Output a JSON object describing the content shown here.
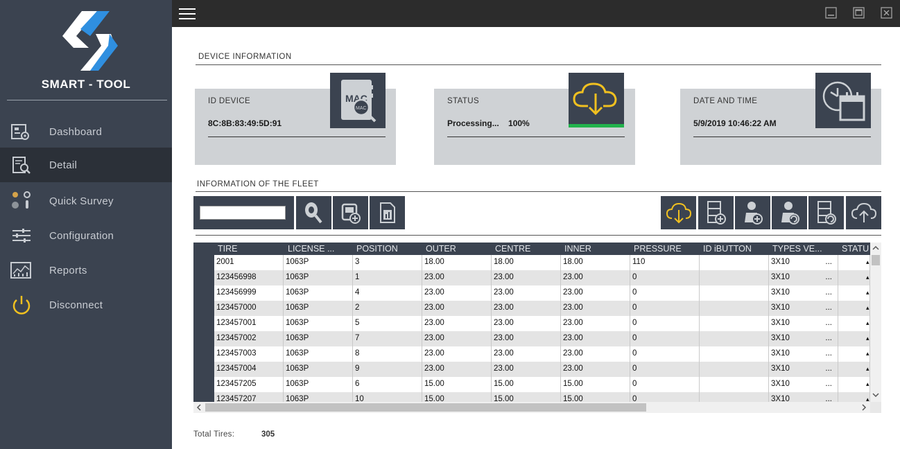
{
  "brand": "SMART - TOOL",
  "nav": [
    {
      "label": "Dashboard",
      "icon": "dashboard-icon"
    },
    {
      "label": "Detail",
      "icon": "detail-icon"
    },
    {
      "label": "Quick  Survey",
      "icon": "quick-survey-icon"
    },
    {
      "label": "Configuration",
      "icon": "configuration-icon"
    },
    {
      "label": "Reports",
      "icon": "reports-icon"
    },
    {
      "label": "Disconnect",
      "icon": "power-icon"
    }
  ],
  "device_section": "DEVICE  INFORMATION",
  "cards": {
    "id": {
      "title": "ID  DEVICE",
      "value": "8C:8B:83:49:5D:91",
      "icon_text": "MAC"
    },
    "status": {
      "title": "STATUS",
      "value": "Processing...    100%",
      "progress": 1.0
    },
    "date": {
      "title": "DATE  AND  TIME",
      "value": "5/9/2019 10:46:22 AM"
    }
  },
  "fleet_section": "INFORMATION  OF  THE  FLEET",
  "filter_value": "",
  "columns": [
    "TIRE",
    "LICENSE ...",
    "POSITION",
    "OUTER",
    "CENTRE",
    "INNER",
    "PRESSURE",
    "ID  iBUTTON",
    "TYPES  VE...",
    "STATU"
  ],
  "rows": [
    [
      "2001",
      "1063P",
      "3",
      "18.00",
      "18.00",
      "18.00",
      "110",
      "",
      "3X10"
    ],
    [
      "123456998",
      "1063P",
      "1",
      "23.00",
      "23.00",
      "23.00",
      "0",
      "",
      "3X10"
    ],
    [
      "123456999",
      "1063P",
      "4",
      "23.00",
      "23.00",
      "23.00",
      "0",
      "",
      "3X10"
    ],
    [
      "123457000",
      "1063P",
      "2",
      "23.00",
      "23.00",
      "23.00",
      "0",
      "",
      "3X10"
    ],
    [
      "123457001",
      "1063P",
      "5",
      "23.00",
      "23.00",
      "23.00",
      "0",
      "",
      "3X10"
    ],
    [
      "123457002",
      "1063P",
      "7",
      "23.00",
      "23.00",
      "23.00",
      "0",
      "",
      "3X10"
    ],
    [
      "123457003",
      "1063P",
      "8",
      "23.00",
      "23.00",
      "23.00",
      "0",
      "",
      "3X10"
    ],
    [
      "123457004",
      "1063P",
      "9",
      "23.00",
      "23.00",
      "23.00",
      "0",
      "",
      "3X10"
    ],
    [
      "123457205",
      "1063P",
      "6",
      "15.00",
      "15.00",
      "15.00",
      "0",
      "",
      "3X10"
    ],
    [
      "123457207",
      "1063P",
      "10",
      "15.00",
      "15.00",
      "15.00",
      "0",
      "",
      "3X10"
    ]
  ],
  "ellipsis": "...",
  "total_label": "Total  Tires:",
  "total_value": "305",
  "colors": {
    "sidebar": "#3b4350",
    "accent": "#f0c020",
    "progress": "#22b24c"
  }
}
